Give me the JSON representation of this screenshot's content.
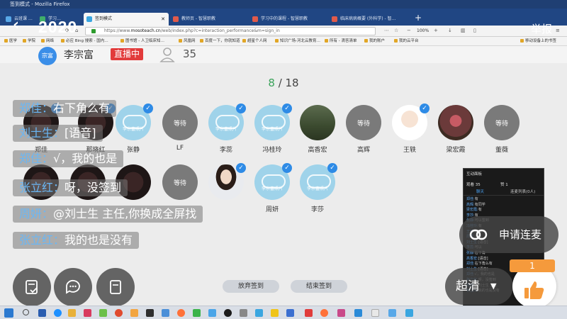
{
  "browser": {
    "window_title": "签到模式 - Mozilla Firefox",
    "tabs": [
      {
        "label": "云班课 …"
      },
      {
        "label": "学习…"
      },
      {
        "label": "签到模式",
        "active": true
      },
      {
        "label": "教师页 - 智慧职教"
      },
      {
        "label": "学习中的课程 - 智慧职教"
      },
      {
        "label": "临床病病概要 (外科学) - 智…"
      }
    ],
    "url_prefix": "https://www.",
    "url_host": "mosoteach.cn",
    "url_path": "/web/index.php?c=interaction_performance&m=sign_in",
    "zoom": "100%",
    "bookmarks": [
      "医学",
      "学院",
      "网络",
      "必应 Bing 搜索 - 国内…",
      "图书馆 - 人卫临床知…",
      "风凰网",
      "百度一下，你就知道",
      "超星个人网",
      "知识广场-河北云教育…",
      "所有 - 滴答清单",
      "我的账户",
      "我的云平台",
      "移动设备上的书签"
    ]
  },
  "stream": {
    "title": "2020",
    "report_label": "举报",
    "teacher_avatar_text": "宗富",
    "teacher_name": "李宗富",
    "live_badge": "直播中",
    "viewer_count": "35"
  },
  "sign_in": {
    "done": "8",
    "separator": " / ",
    "total": "18"
  },
  "attendees": [
    {
      "name": "郑佳",
      "avatar": "photo-dark",
      "status": "signed",
      "overlay": ""
    },
    {
      "name": "那晓红",
      "avatar": "photo-dark",
      "status": "signed",
      "overlay": ""
    },
    {
      "name": "张静",
      "avatar": "cloud",
      "status": "signed",
      "overlay": "李宗富照片"
    },
    {
      "name": "LF",
      "avatar": "wait",
      "status": "waiting",
      "overlay": "等待"
    },
    {
      "name": "李蕊",
      "avatar": "cloud",
      "status": "signed",
      "overlay": "李宗富照片"
    },
    {
      "name": "冯桂玲",
      "avatar": "cloud",
      "status": "signed",
      "overlay": "李宗富照片"
    },
    {
      "name": "高香宏",
      "avatar": "photo-forest",
      "status": "waiting",
      "overlay": ""
    },
    {
      "name": "高辉",
      "avatar": "wait",
      "status": "waiting",
      "overlay": "等待"
    },
    {
      "name": "王轶",
      "avatar": "photo-girl",
      "status": "signed",
      "overlay": ""
    },
    {
      "name": "梁宏霞",
      "avatar": "photo-flower",
      "status": "waiting",
      "overlay": ""
    },
    {
      "name": "董薇",
      "avatar": "wait",
      "status": "waiting",
      "overlay": "等待"
    },
    {
      "name": "",
      "avatar": "photo-dark",
      "status": "waiting",
      "overlay": ""
    },
    {
      "name": "",
      "avatar": "photo-dark",
      "status": "waiting",
      "overlay": ""
    },
    {
      "name": "",
      "avatar": "photo-dark",
      "status": "waiting",
      "overlay": ""
    },
    {
      "name": "",
      "avatar": "wait",
      "status": "waiting",
      "overlay": "等待"
    },
    {
      "name": "",
      "avatar": "photo-woman",
      "status": "signed",
      "overlay": ""
    },
    {
      "name": "周妍",
      "avatar": "cloud",
      "status": "signed",
      "overlay": "李宗富照片"
    },
    {
      "name": "李莎",
      "avatar": "cloud",
      "status": "signed",
      "overlay": "李宗富照片"
    }
  ],
  "chat": [
    {
      "sender": "郑佳：",
      "text": "右下角么有"
    },
    {
      "sender": "刘士生：",
      "text": "[语音]"
    },
    {
      "sender": "郑佳：",
      "text": "√，我的也是"
    },
    {
      "sender": "张立红：",
      "text": "呀，没签到"
    },
    {
      "sender": "周妍：",
      "text": "@刘士生 主任,你换成全屏找"
    },
    {
      "sender": "张立红：",
      "text": "我的也是没有"
    }
  ],
  "panel": {
    "title": "互动面板",
    "stats_left": "观看 35",
    "stats_right": "赞 1",
    "tab_left": "聊天",
    "tab_right": "连麦列表(0人)",
    "rows": [
      {
        "who": "郑佳:",
        "text": "有"
      },
      {
        "who": "高辉:",
        "text": "有同学"
      },
      {
        "who": "梁宏霞:",
        "text": "有"
      },
      {
        "who": "李莎:",
        "text": "有"
      },
      {
        "who": "张静:",
        "text": "可以签到"
      },
      {
        "who": "冯桂玲:",
        "text": "有"
      },
      {
        "who": "王轶:",
        "text": "签到"
      },
      {
        "who": "周妍:",
        "text": "可以"
      },
      {
        "who": "刘士生:",
        "text": "[语音]"
      },
      {
        "who": "李蕊:",
        "text": "可以"
      },
      {
        "who": "张静:",
        "text": "右下角"
      },
      {
        "who": "高香宏:",
        "text": "[语音]"
      },
      {
        "who": "郑佳:",
        "text": "右下角么有"
      },
      {
        "who": "刘士生:",
        "text": "[语音]"
      },
      {
        "who": "郑佳:",
        "text": "√，我的也是"
      },
      {
        "who": "张立红:",
        "text": "呀，没签到"
      },
      {
        "who": "周妍:",
        "text": "@刘士生 主任"
      },
      {
        "who": "张立红:",
        "text": "我的也是没有"
      }
    ]
  },
  "controls": {
    "apply_mic": "申请连麦",
    "quality": "超清",
    "like_count": "1",
    "abandon_sign": "放弃签到",
    "end_sign": "结束签到"
  },
  "taskbar": {
    "time": "15:xx",
    "date": "2020/x/x"
  },
  "colors": {
    "accent_blue": "#2e8be6",
    "live_red": "#e23b3b",
    "done_green": "#3aa25a",
    "like_orange": "#f59a3c"
  }
}
